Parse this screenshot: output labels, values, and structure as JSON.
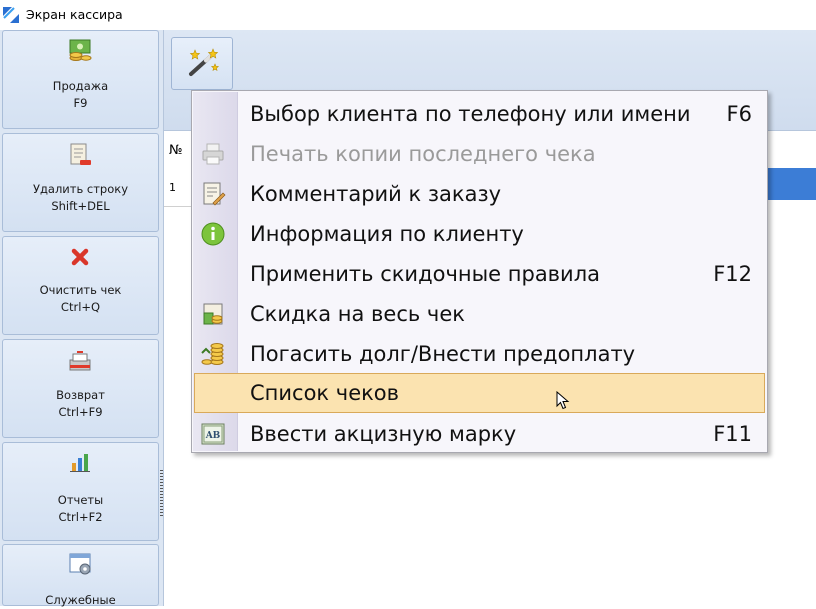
{
  "window": {
    "title": "Экран кассира",
    "icon": "app-icon"
  },
  "sidebar": {
    "buttons": [
      {
        "label": "Продажа",
        "shortcut": "F9",
        "icon": "sale-money-icon"
      },
      {
        "label": "Удалить строку",
        "shortcut": "Shift+DEL",
        "icon": "delete-row-icon"
      },
      {
        "label": "Очистить чек",
        "shortcut": "Ctrl+Q",
        "icon": "clear-x-icon"
      },
      {
        "label": "Возврат",
        "shortcut": "Ctrl+F9",
        "icon": "return-icon"
      },
      {
        "label": "Отчеты",
        "shortcut": "Ctrl+F2",
        "icon": "report-chart-icon"
      },
      {
        "label": "Служебные",
        "shortcut": "",
        "icon": "service-icon"
      }
    ]
  },
  "toolbar": {
    "magic_icon": "magic-wand-icon"
  },
  "grid": {
    "col_no": "№",
    "row_no": "1"
  },
  "menu": {
    "items": [
      {
        "label": "Выбор клиента по телефону или имени",
        "shortcut": "F6",
        "icon": "",
        "enabled": true
      },
      {
        "label": "Печать копии последнего чека",
        "shortcut": "",
        "icon": "printer-icon",
        "enabled": false
      },
      {
        "label": "Комментарий к заказу",
        "shortcut": "",
        "icon": "comment-icon",
        "enabled": true
      },
      {
        "label": "Информация по клиенту",
        "shortcut": "",
        "icon": "info-icon",
        "enabled": true
      },
      {
        "label": "Применить скидочные правила",
        "shortcut": "F12",
        "icon": "",
        "enabled": true
      },
      {
        "label": "Скидка на весь чек",
        "shortcut": "",
        "icon": "discount-icon",
        "enabled": true
      },
      {
        "label": "Погасить долг/Внести предоплату",
        "shortcut": "",
        "icon": "coins-icon",
        "enabled": true
      },
      {
        "label": "Список чеков",
        "shortcut": "",
        "icon": "",
        "enabled": true,
        "highlighted": true
      },
      {
        "label": "Ввести акцизную марку",
        "shortcut": "F11",
        "icon": "excise-stamp-icon",
        "enabled": true
      }
    ]
  },
  "colors": {
    "highlight": "#fbe3b0",
    "selection": "#3c7dd6",
    "panel": "#dce6f3"
  }
}
